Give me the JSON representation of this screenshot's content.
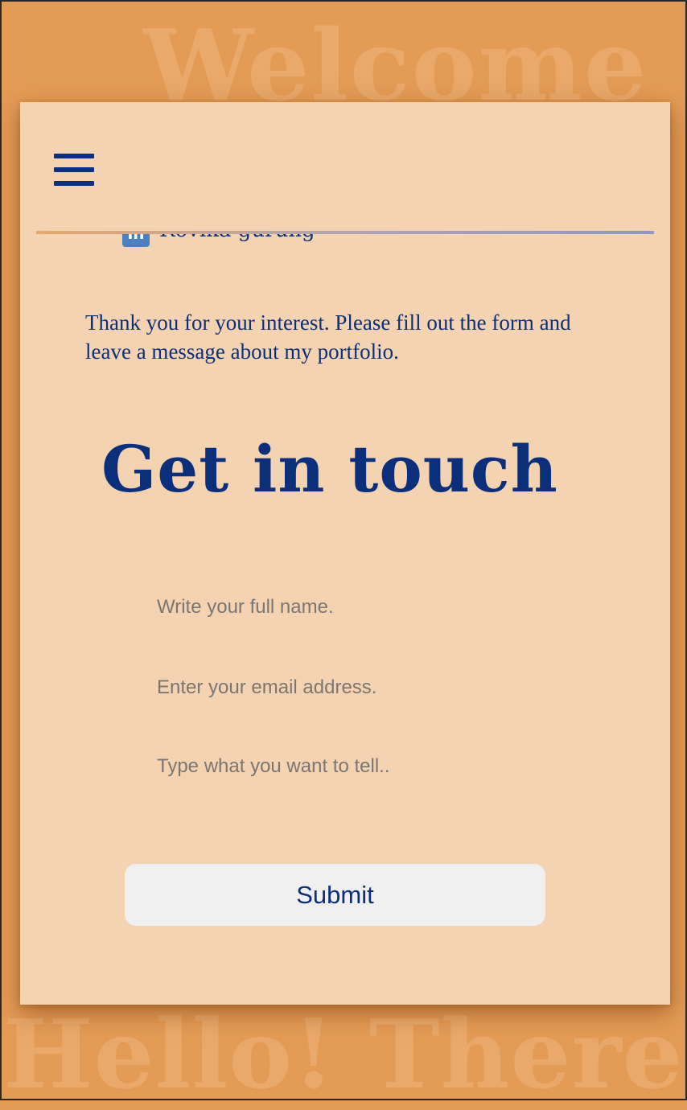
{
  "background": {
    "top_word": "Welcome",
    "bottom_word": "Hello! There."
  },
  "nav": {
    "menu_icon": "hamburger-icon"
  },
  "social": {
    "icon": "linkedin-icon",
    "icon_glyph": "in",
    "name": "Rovika gurung"
  },
  "intro": {
    "text": "Thank you for your interest. Please fill out the form and leave a message about my portfolio."
  },
  "contact": {
    "heading": "Get in touch",
    "name_placeholder": "Write your full name.",
    "email_placeholder": "Enter your email address.",
    "message_placeholder": "Type what you want to tell..",
    "submit_label": "Submit"
  },
  "colors": {
    "background": "#E39C56",
    "card": "#F3D3B1",
    "text": "#0B2F7A",
    "button": "#F0F0F0"
  }
}
